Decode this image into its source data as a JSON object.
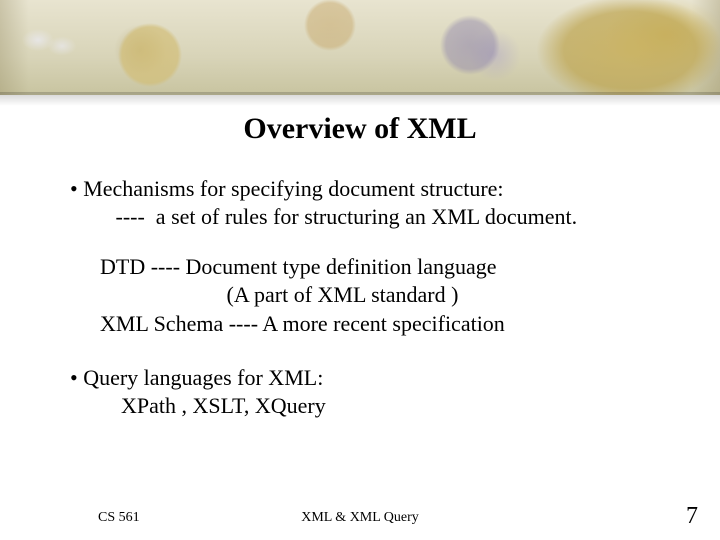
{
  "title": "Overview of XML",
  "bullet1": {
    "line1": "Mechanisms for specifying document structure:",
    "line2": "     ----  a set of rules for structuring an XML document."
  },
  "sub1": {
    "line1": "DTD ---- Document type definition language",
    "line2": "                       (A part of XML standard )",
    "line3": "XML Schema ---- A more recent specification"
  },
  "bullet2": {
    "line1": "Query languages for XML:",
    "line2": "      XPath , XSLT, XQuery"
  },
  "footer": {
    "left": "CS 561",
    "center": "XML & XML Query",
    "page": "7"
  }
}
